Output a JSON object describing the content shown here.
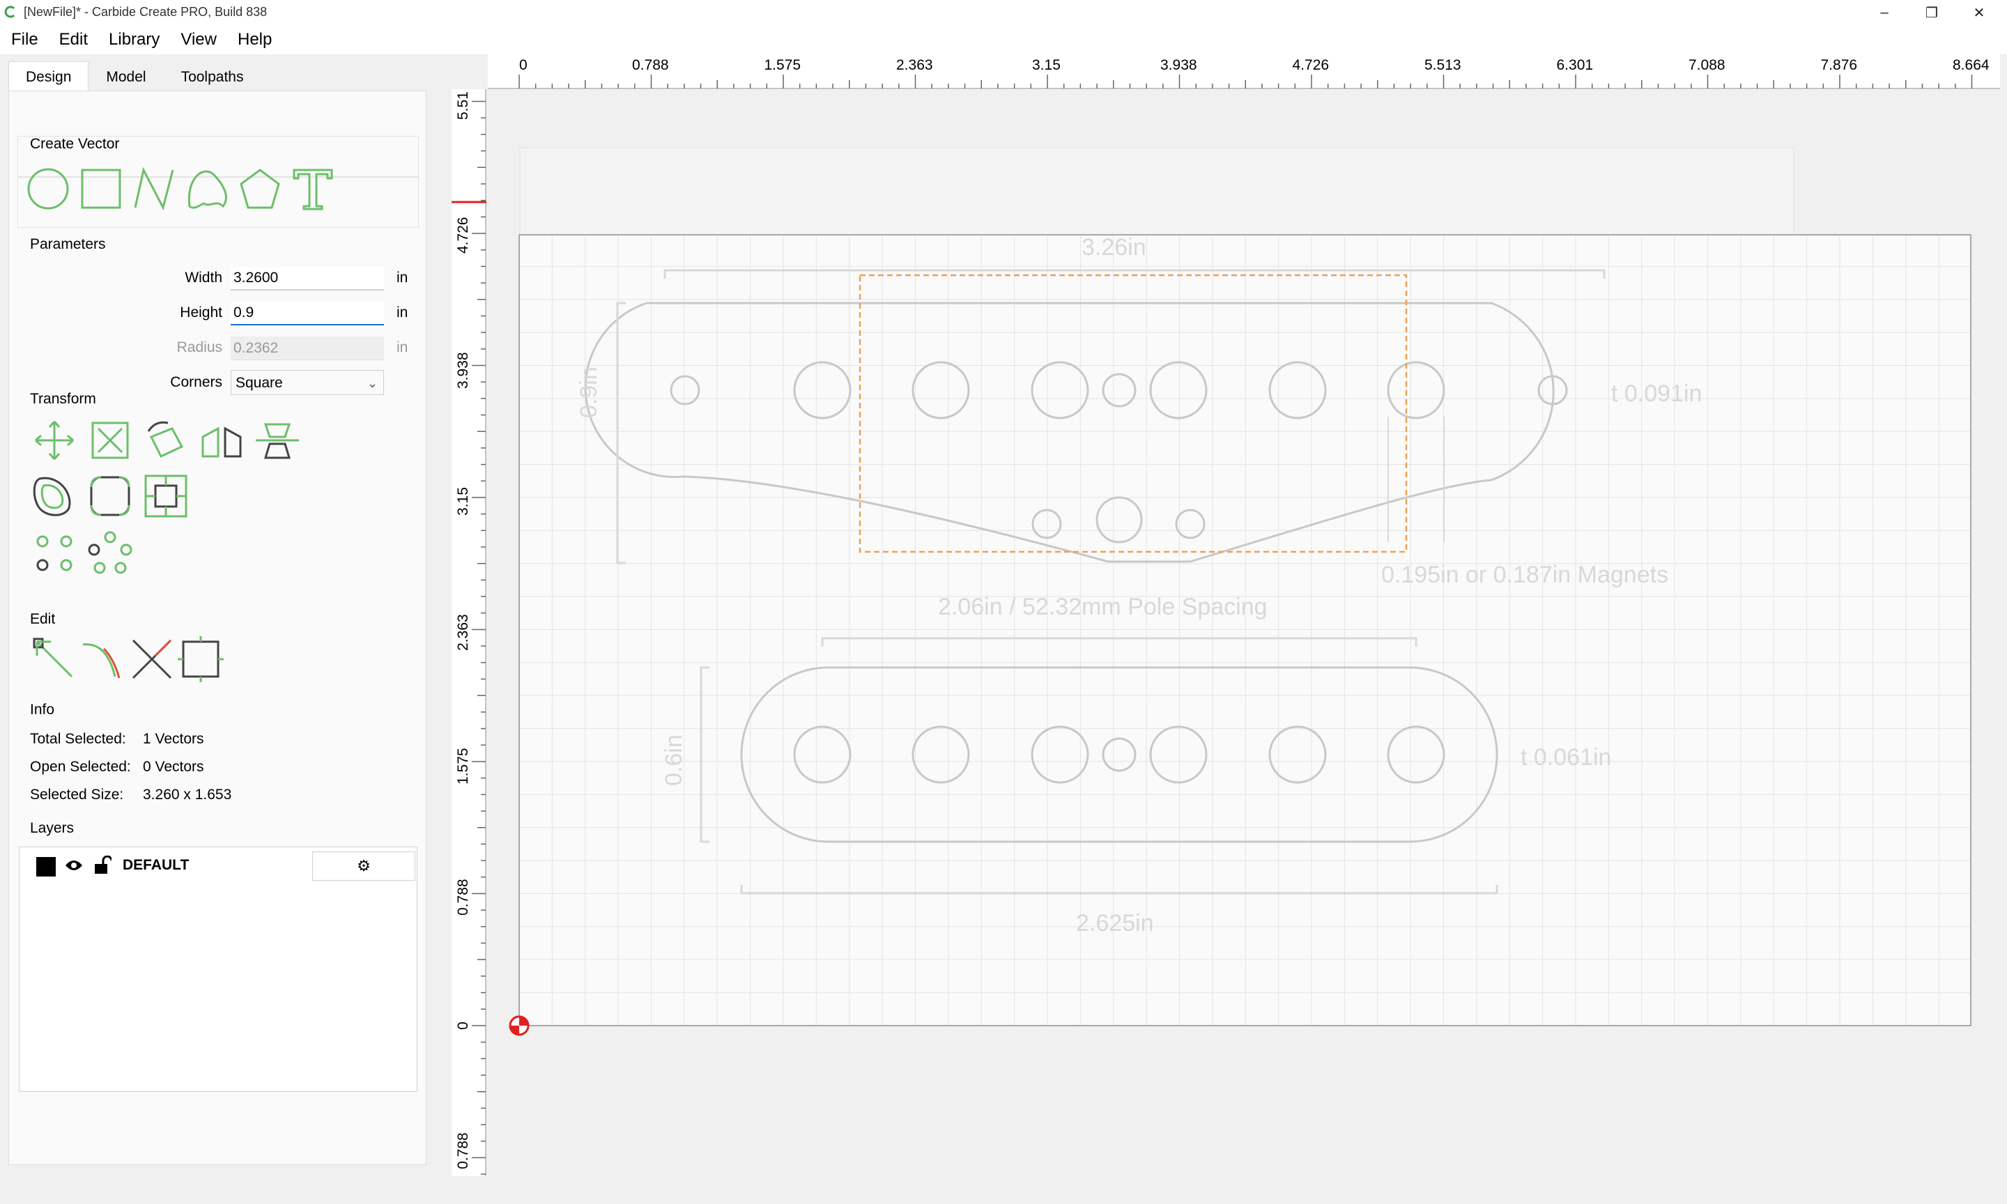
{
  "window": {
    "title": "[NewFile]* - Carbide Create PRO, Build 838",
    "minimize": "–",
    "maximize": "❐",
    "close": "✕"
  },
  "menu": [
    "File",
    "Edit",
    "Library",
    "View",
    "Help"
  ],
  "tabs": [
    "Design",
    "Model",
    "Toolpaths"
  ],
  "active_tab": "Design",
  "create_vector": {
    "title": "Create Vector",
    "tools": [
      "circle-icon",
      "rectangle-icon",
      "polyline-icon",
      "curve-icon",
      "polygon-icon",
      "text-icon"
    ]
  },
  "parameters": {
    "title": "Parameters",
    "width_label": "Width",
    "width_value": "3.2600",
    "width_unit": "in",
    "height_label": "Height",
    "height_value": "0.9",
    "height_unit": "in",
    "radius_label": "Radius",
    "radius_value": "0.2362",
    "radius_unit": "in",
    "corners_label": "Corners",
    "corners_value": "Square"
  },
  "transform": {
    "title": "Transform",
    "tools": [
      "move-icon",
      "scale-icon",
      "rotate-icon",
      "mirror-icon",
      "align-icon",
      "offset-icon",
      "fillet-icon",
      "bounding-box-icon",
      "circular-pattern-icon",
      "array-pattern-icon"
    ]
  },
  "edit": {
    "title": "Edit",
    "tools": [
      "node-edit-icon",
      "trim-icon",
      "cut-icon",
      "join-icon"
    ]
  },
  "info": {
    "title": "Info",
    "total_selected_label": "Total Selected:",
    "total_selected_value": "1 Vectors",
    "open_selected_label": "Open Selected:",
    "open_selected_value": "0 Vectors",
    "selected_size_label": "Selected Size:",
    "selected_size_value": "3.260 x 1.653"
  },
  "layers": {
    "title": "Layers",
    "items": [
      {
        "name": "DEFAULT",
        "color": "#000000"
      }
    ]
  },
  "ruler_top": [
    "0",
    "0.788",
    "1.575",
    "2.363",
    "3.15",
    "3.938",
    "4.726",
    "5.513",
    "6.301",
    "7.088",
    "7.876",
    "8.664"
  ],
  "ruler_left": [
    "5.51",
    "4.726",
    "3.938",
    "3.15",
    "2.363",
    "1.575",
    "0.788",
    "0",
    "0.788"
  ],
  "annotations": {
    "top_width": "3.26in",
    "top_height": "0.9in",
    "top_thickness": "t 0.091in",
    "magnets": "0.195in or 0.187in Magnets",
    "pole_spacing": "2.06in / 52.32mm Pole Spacing",
    "bottom_height": "0.6in",
    "bottom_thickness": "t 0.061in",
    "bottom_width": "2.625in"
  },
  "colors": {
    "accent_green": "#6cbf6a",
    "selection_orange": "#f0a050",
    "drawing_gray": "#c8c8c8",
    "grid": "#e4e4e4",
    "focus_blue": "#1a6ed8"
  }
}
